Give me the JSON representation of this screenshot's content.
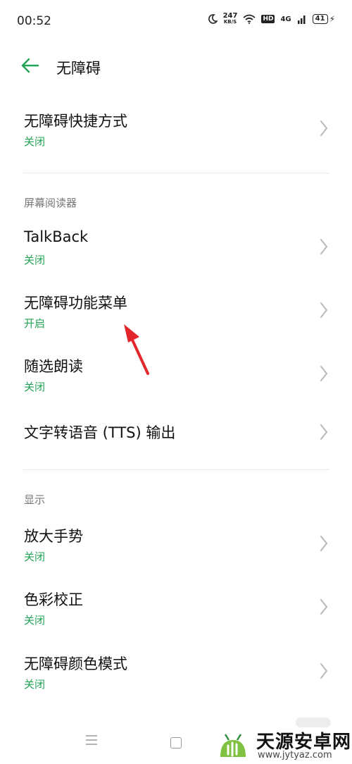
{
  "status_bar": {
    "time": "00:52",
    "net_speed_value": "247",
    "net_speed_unit": "KB/S",
    "hd_label": "HD",
    "signal_label": "4G",
    "battery": "41"
  },
  "app_bar": {
    "title": "无障碍"
  },
  "items": {
    "shortcut": {
      "title": "无障碍快捷方式",
      "status": "关闭"
    },
    "talkback": {
      "title": "TalkBack",
      "status": "关闭"
    },
    "menu": {
      "title": "无障碍功能菜单",
      "status": "开启"
    },
    "select_to_speak": {
      "title": "随选朗读",
      "status": "关闭"
    },
    "tts": {
      "title": "文字转语音 (TTS) 输出"
    },
    "magnify": {
      "title": "放大手势",
      "status": "关闭"
    },
    "color_correction": {
      "title": "色彩校正",
      "status": "关闭"
    },
    "color_mode": {
      "title": "无障碍颜色模式",
      "status": "关闭"
    }
  },
  "sections": {
    "screen_reader": "屏幕阅读器",
    "display": "显示"
  },
  "watermark": {
    "name": "天源安卓网",
    "url": "www.jytyaz.com"
  },
  "colors": {
    "accent_green": "#21a355",
    "annotation_arrow": "#e3262b"
  }
}
